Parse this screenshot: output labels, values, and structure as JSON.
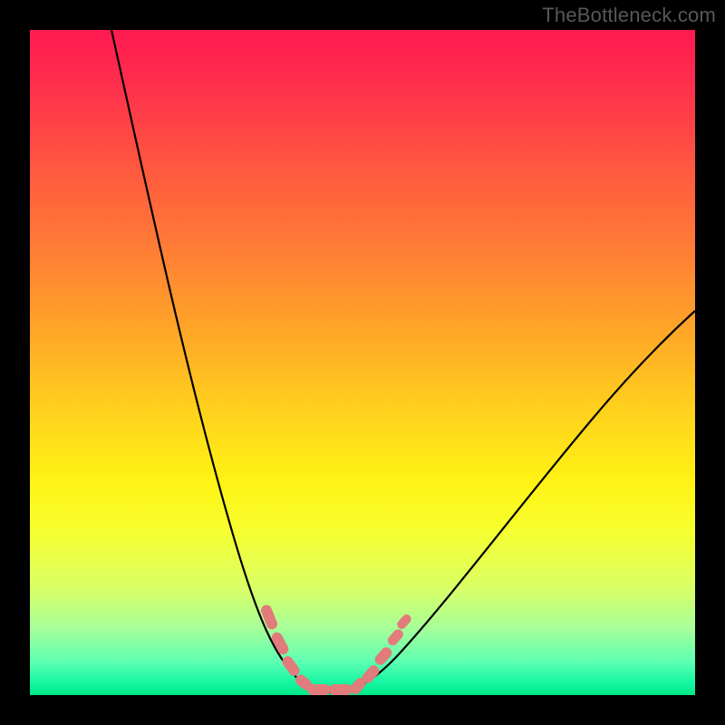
{
  "watermark": "TheBottleneck.com",
  "colors": {
    "frame_bg": "#000000",
    "watermark_text": "#58585a",
    "curve_stroke": "#000000",
    "marker_fill": "#e27b7b",
    "gradient_top": "#ff1a50",
    "gradient_bottom": "#00e888"
  },
  "chart_data": {
    "type": "line",
    "title": "",
    "xlabel": "",
    "ylabel": "",
    "xlim": [
      0,
      100
    ],
    "ylim": [
      0,
      100
    ],
    "grid": false,
    "legend": false,
    "series": [
      {
        "name": "left-branch",
        "x": [
          12,
          16,
          20,
          25,
          30,
          34,
          38,
          41,
          44,
          45
        ],
        "y": [
          100,
          78,
          58,
          40,
          25,
          14,
          6,
          2,
          0.5,
          0.3
        ]
      },
      {
        "name": "right-branch",
        "x": [
          45,
          48,
          52,
          58,
          66,
          76,
          86,
          96,
          100
        ],
        "y": [
          0.3,
          1,
          4,
          10,
          22,
          36,
          48,
          56,
          58
        ]
      }
    ],
    "markers_x_range": [
      35,
      56
    ],
    "annotations": []
  }
}
